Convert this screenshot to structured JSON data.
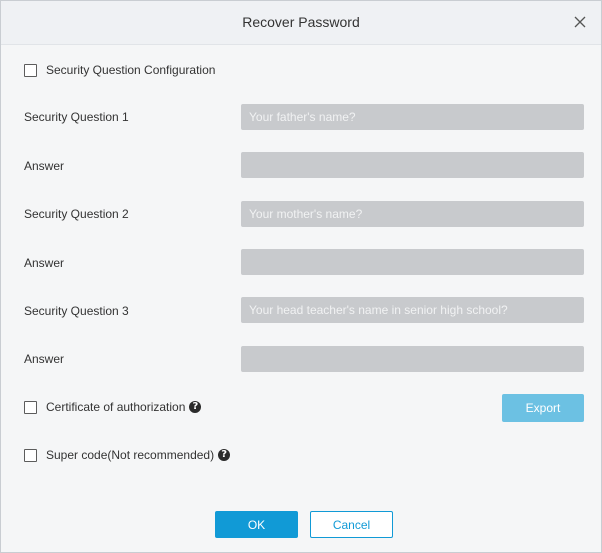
{
  "dialog": {
    "title": "Recover Password",
    "close_icon": "close-icon"
  },
  "security_config": {
    "label": "Security Question Configuration",
    "checked": false
  },
  "questions": [
    {
      "label": "Security Question 1",
      "placeholder": "Your father's name?",
      "value": ""
    },
    {
      "label": "Security Question 2",
      "placeholder": "Your mother's name?",
      "value": ""
    },
    {
      "label": "Security Question 3",
      "placeholder": "Your head teacher's name in senior high school?",
      "value": ""
    }
  ],
  "answers": [
    {
      "label": "Answer",
      "value": ""
    },
    {
      "label": "Answer",
      "value": ""
    },
    {
      "label": "Answer",
      "value": ""
    }
  ],
  "certificate": {
    "label": "Certificate of authorization",
    "checked": false,
    "help_icon": "question-circle-icon",
    "export_label": "Export"
  },
  "super_code": {
    "label": "Super code(Not recommended)",
    "checked": false,
    "help_icon": "question-circle-icon"
  },
  "footer": {
    "ok_label": "OK",
    "cancel_label": "Cancel"
  },
  "colors": {
    "primary": "#119ad6",
    "export_disabled": "#6cc1e3",
    "input_disabled": "#c8cacd",
    "titlebar_bg": "#eff1f4",
    "body_bg": "#f5f6f7"
  }
}
